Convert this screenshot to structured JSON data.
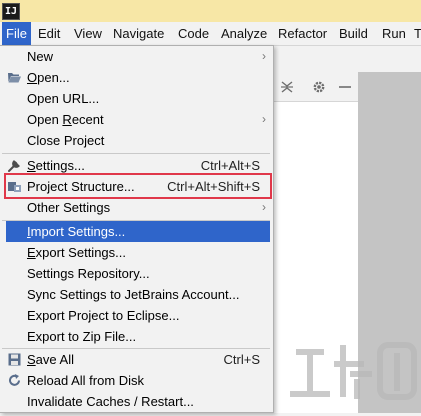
{
  "app": {
    "logo_text": "IJ"
  },
  "menubar": {
    "items": [
      {
        "label": "File",
        "active": true
      },
      {
        "label": "Edit"
      },
      {
        "label": "View"
      },
      {
        "label": "Navigate"
      },
      {
        "label": "Code"
      },
      {
        "label": "Analyze"
      },
      {
        "label": "Refactor"
      },
      {
        "label": "Build"
      },
      {
        "label": "Run"
      },
      {
        "label": "T"
      }
    ]
  },
  "file_menu": {
    "items": [
      {
        "label": "New",
        "submenu": true
      },
      {
        "label": "Open...",
        "icon": "folder-open-icon"
      },
      {
        "label": "Open URL..."
      },
      {
        "label": "Open Recent",
        "submenu": true
      },
      {
        "label": "Close Project"
      },
      {
        "label": "Settings...",
        "shortcut": "Ctrl+Alt+S",
        "icon": "wrench-icon"
      },
      {
        "label": "Project Structure...",
        "shortcut": "Ctrl+Alt+Shift+S",
        "icon": "project-structure-icon"
      },
      {
        "label": "Other Settings",
        "submenu": true
      },
      {
        "label": "Import Settings...",
        "highlighted": true
      },
      {
        "label": "Export Settings..."
      },
      {
        "label": "Settings Repository..."
      },
      {
        "label": "Sync Settings to JetBrains Account..."
      },
      {
        "label": "Export Project to Eclipse..."
      },
      {
        "label": "Export to Zip File..."
      },
      {
        "label": "Save All",
        "shortcut": "Ctrl+S",
        "icon": "save-icon"
      },
      {
        "label": "Reload All from Disk",
        "icon": "reload-icon"
      },
      {
        "label": "Invalidate Caches / Restart..."
      }
    ],
    "submenu_arrow": "›"
  },
  "toolbar": {
    "collapse_icon": "collapse-icon",
    "gear_icon": "gear-icon",
    "minimize_icon": "minimize-icon"
  },
  "colors": {
    "titlebar": "#f7e7a6",
    "selection": "#2f65ca",
    "annotation_frame": "#e0384a"
  }
}
